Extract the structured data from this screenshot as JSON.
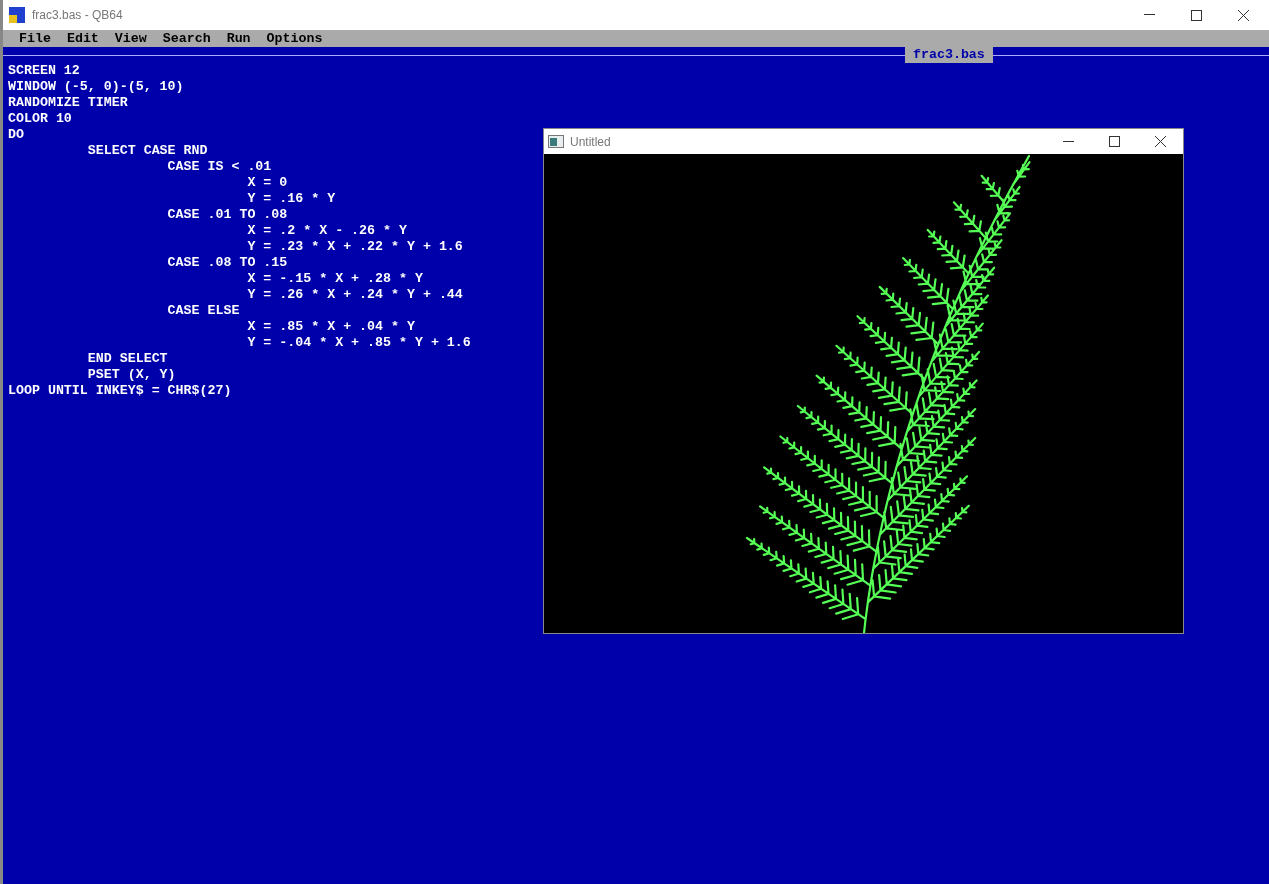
{
  "window": {
    "title": "frac3.bas - QB64"
  },
  "menu": [
    "File",
    "Edit",
    "View",
    "Search",
    "Run",
    "Options"
  ],
  "editor": {
    "tab": "frac3.bas",
    "lines": [
      "SCREEN 12",
      "WINDOW (-5, 0)-(5, 10)",
      "RANDOMIZE TIMER",
      "COLOR 10",
      "DO",
      "          SELECT CASE RND",
      "                    CASE IS < .01",
      "                              X = 0",
      "                              Y = .16 * Y",
      "                    CASE .01 TO .08",
      "                              X = .2 * X - .26 * Y",
      "                              Y = .23 * X + .22 * Y + 1.6",
      "                    CASE .08 TO .15",
      "                              X = -.15 * X + .28 * Y",
      "                              Y = .26 * X + .24 * Y + .44",
      "                    CASE ELSE",
      "                              X = .85 * X + .04 * Y",
      "                              Y = -.04 * X + .85 * Y + 1.6",
      "          END SELECT",
      "          PSET (X, Y)",
      "LOOP UNTIL INKEY$ = CHR$(27)"
    ]
  },
  "output_window": {
    "title": "Untitled"
  }
}
